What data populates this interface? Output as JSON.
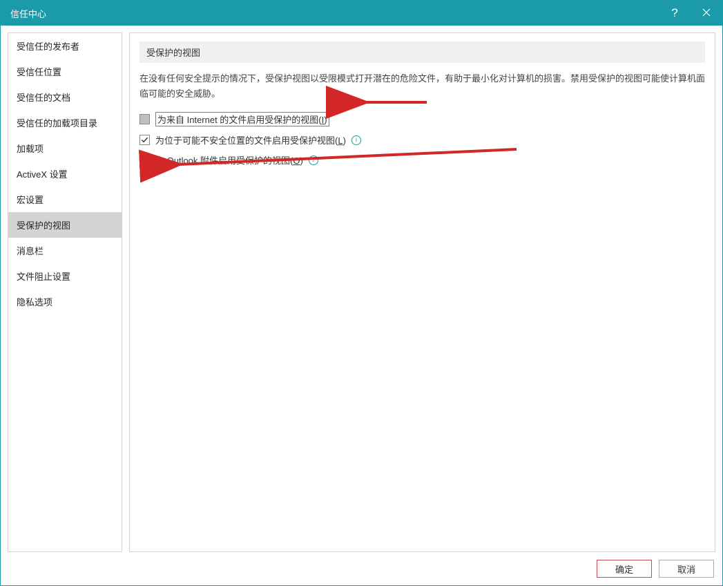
{
  "window": {
    "title": "信任中心",
    "help_tooltip": "?",
    "close_tooltip": "×"
  },
  "sidebar": {
    "items": [
      {
        "label": "受信任的发布者",
        "selected": false
      },
      {
        "label": "受信任位置",
        "selected": false
      },
      {
        "label": "受信任的文档",
        "selected": false
      },
      {
        "label": "受信任的加载项目录",
        "selected": false
      },
      {
        "label": "加载项",
        "selected": false
      },
      {
        "label": "ActiveX 设置",
        "selected": false
      },
      {
        "label": "宏设置",
        "selected": false
      },
      {
        "label": "受保护的视图",
        "selected": true
      },
      {
        "label": "消息栏",
        "selected": false
      },
      {
        "label": "文件阻止设置",
        "selected": false
      },
      {
        "label": "隐私选项",
        "selected": false
      }
    ]
  },
  "content": {
    "section_title": "受保护的视图",
    "description": "在没有任何安全提示的情况下，受保护视图以受限模式打开潜在的危险文件，有助于最小化对计算机的损害。禁用受保护的视图可能使计算机面临可能的安全威胁。",
    "options": [
      {
        "state": "indeterminate",
        "label_pre": "为来自 Internet 的文件启用受保护的视图(",
        "hotkey": "I",
        "label_post": ")",
        "highlight": true,
        "info": false
      },
      {
        "state": "checked",
        "label_pre": "为位于可能不安全位置的文件启用受保护视图(",
        "hotkey": "L",
        "label_post": ")",
        "highlight": false,
        "info": true
      },
      {
        "state": "unchecked",
        "label_pre": "为 Outlook 附件启用受保护的视图(",
        "hotkey": "O",
        "label_post": ")",
        "highlight": false,
        "info": true
      }
    ]
  },
  "footer": {
    "ok": "确定",
    "cancel": "取消"
  },
  "annotations": {
    "arrow_color": "#d32626"
  }
}
